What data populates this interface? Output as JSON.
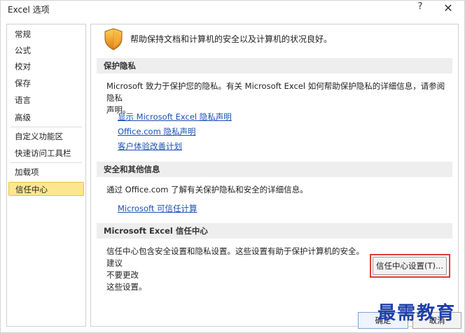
{
  "window": {
    "title": "Excel 选项",
    "help_label": "?",
    "close_label": "✕"
  },
  "sidebar": {
    "items": [
      {
        "label": "常规"
      },
      {
        "label": "公式"
      },
      {
        "label": "校对"
      },
      {
        "label": "保存"
      },
      {
        "label": "语言"
      },
      {
        "label": "高级"
      },
      {
        "label": "自定义功能区"
      },
      {
        "label": "快速访问工具栏"
      },
      {
        "label": "加载项"
      },
      {
        "label": "信任中心"
      }
    ],
    "selected": "信任中心"
  },
  "content": {
    "intro": "帮助保持文档和计算机的安全以及计算机的状况良好。",
    "privacy": {
      "header": "保护隐私",
      "text_line1": "Microsoft 致力于保护您的隐私。有关 Microsoft Excel 如何帮助保护隐私的详细信息，请参阅隐私",
      "text_line2": "声明。",
      "links": [
        "显示 Microsoft Excel 隐私声明",
        "Office.com 隐私声明",
        "客户体验改善计划"
      ]
    },
    "security": {
      "header": "安全和其他信息",
      "text": "通过 Office.com 了解有关保护隐私和安全的详细信息。",
      "link": "Microsoft 可信任计算"
    },
    "trust_center": {
      "header": "Microsoft Excel 信任中心",
      "text_line1": "信任中心包含安全设置和隐私设置。这些设置有助于保护计算机的安全。建议",
      "text_line2": "不要更改",
      "text_line3": "这些设置。",
      "button_label": "信任中心设置(T)..."
    }
  },
  "footer": {
    "ok_label": "确定",
    "cancel_label": "取消"
  },
  "watermark": "最需教育",
  "colors": {
    "selected_bg": "#fce690",
    "link": "#1a4fb5",
    "highlight": "#e33a3a",
    "watermark": "#1f3fa8"
  }
}
